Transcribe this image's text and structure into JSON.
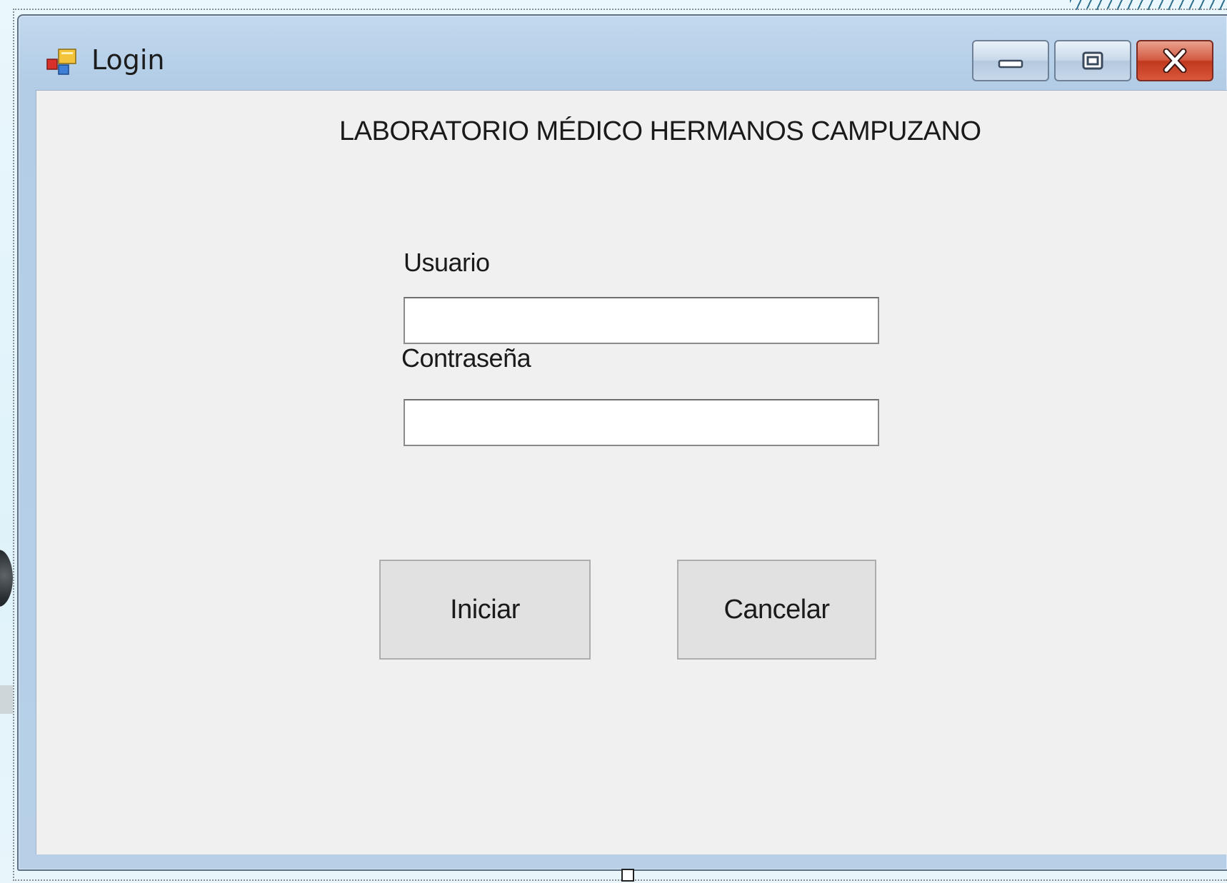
{
  "window": {
    "title": "Login",
    "icon": "windows-forms-app-icon",
    "controls": {
      "minimize_icon": "minimize-icon",
      "maximize_icon": "maximize-icon",
      "close_icon": "close-icon"
    }
  },
  "form": {
    "heading": "LABORATORIO MÉDICO HERMANOS CAMPUZANO",
    "user_label": "Usuario",
    "user_value": "",
    "password_label": "Contraseña",
    "password_value": "",
    "start_button": "Iniciar",
    "cancel_button": "Cancelar"
  },
  "colors": {
    "titlebar": "#b3cde7",
    "client_background": "#f0f0f0",
    "button_face": "#e1e1e1",
    "close_button": "#c0391f"
  }
}
